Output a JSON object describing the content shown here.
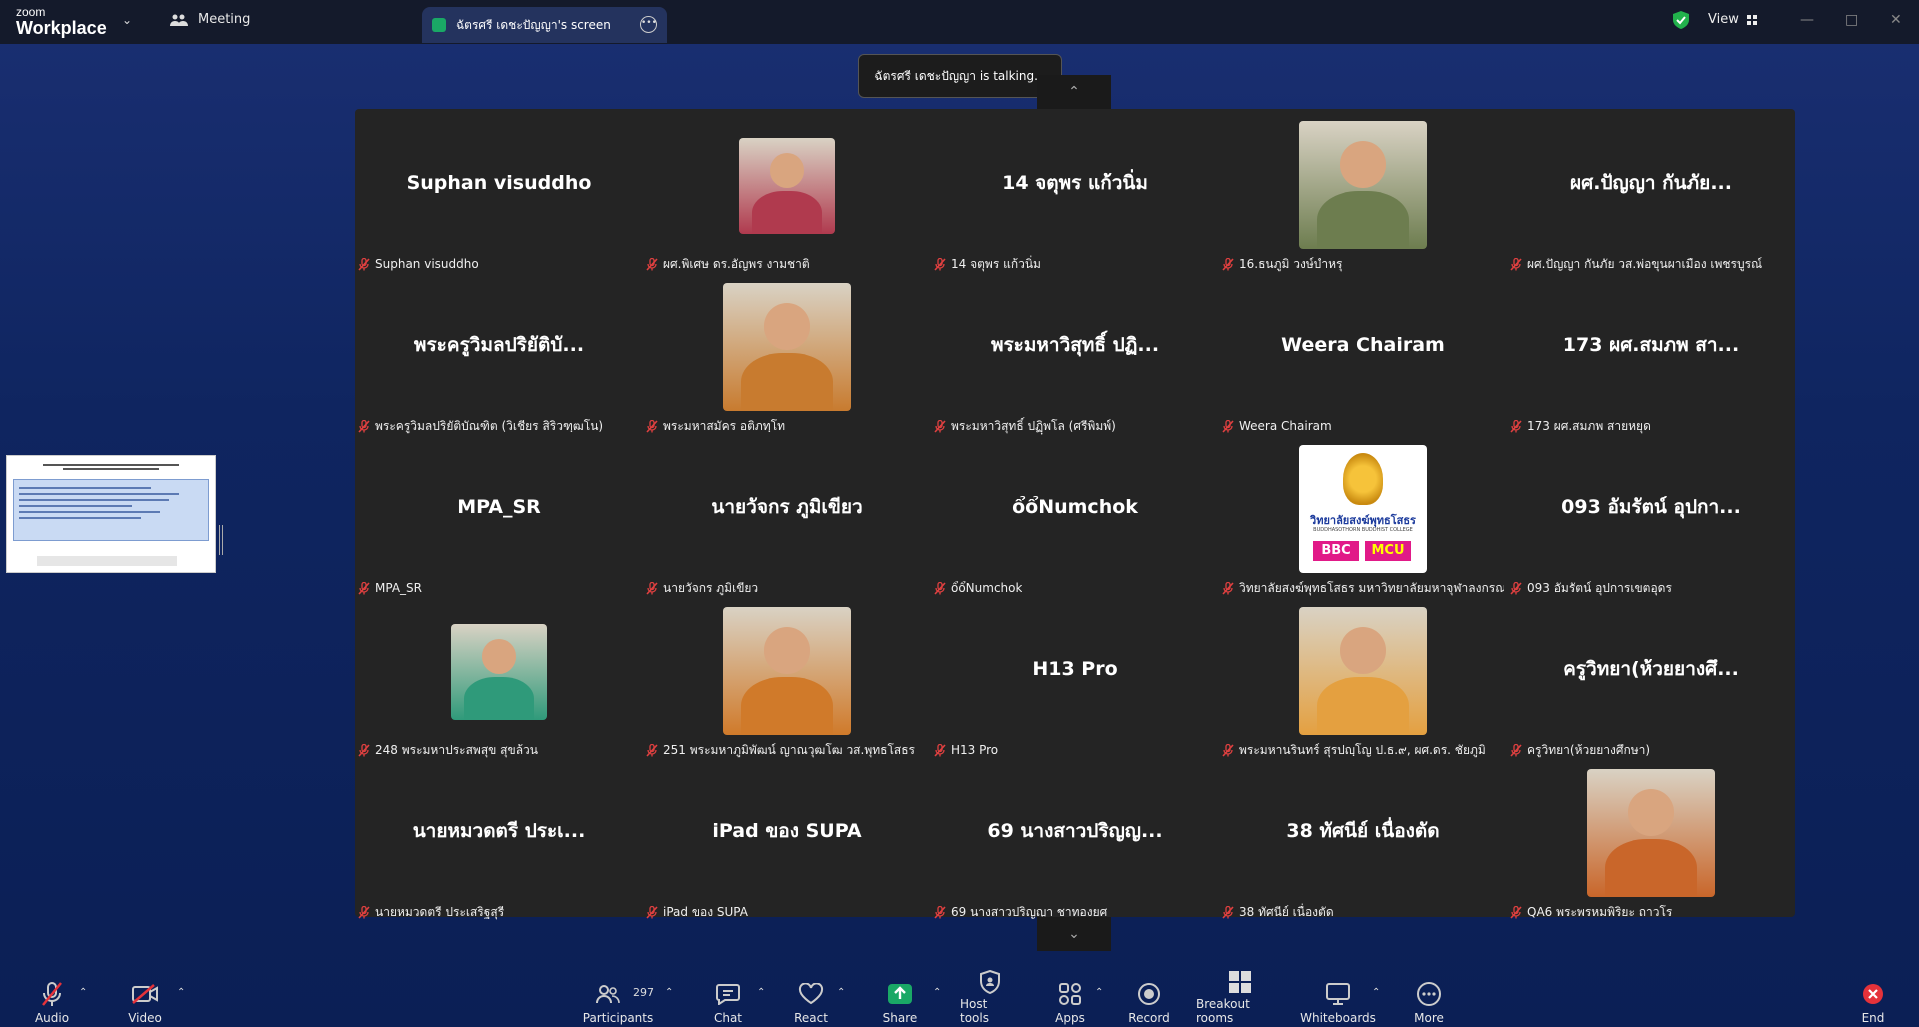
{
  "app": {
    "logo_top": "zoom",
    "logo_bottom": "Workplace"
  },
  "tabs": {
    "meeting": "Meeting",
    "screen": "ฉัตรศรี เดชะปัญญา's screen"
  },
  "view_label": "View",
  "talking": "ฉัตรศรี เดชะปัญญา is talking...",
  "participants": [
    {
      "big": "Suphan visuddho",
      "label": "Suphan visuddho"
    },
    {
      "big": "",
      "label": "ผศ.พิเศษ ดร.อัญพร งามชาติ",
      "photo": "portrait-woman",
      "color": "#b03a4e"
    },
    {
      "big": "14 จตุพร แก้วนิ่ม",
      "label": "14 จตุพร แก้วนิ่ม"
    },
    {
      "big": "",
      "label": "16.ธนภูมิ วงษ์บำหรุ",
      "photo": "tractor-field",
      "color": "#6d7d4f"
    },
    {
      "big": "ผศ.ปัญญา กันภัย...",
      "label": "ผศ.ปัญญา กันภัย วส.พ่อขุนผาเมือง เพชรบูรณ์"
    },
    {
      "big": "พระครูวิมลปริยัติบั...",
      "label": "พระครูวิมลปริยัติบัณฑิต (วิเชียร สิริวฑฺฒโน)"
    },
    {
      "big": "",
      "label": "พระมหาสมัคร อติภทฺโท",
      "photo": "monk-desk",
      "color": "#c87b2f"
    },
    {
      "big": "พระมหาวิสุทธิ์ ปฏิ...",
      "label": "พระมหาวิสุทธิ์ ปฏิฺพโล (ศรีพิมพ์)"
    },
    {
      "big": "Weera Chairam",
      "label": "Weera Chairam"
    },
    {
      "big": "173 ผศ.สมภพ สา...",
      "label": "173 ผศ.สมภพ สายหยุด"
    },
    {
      "big": "MPA_SR",
      "label": "MPA_SR"
    },
    {
      "big": "นายวัจกร ภูมิเขียว",
      "label": "นายวัจกร ภูมิเขียว"
    },
    {
      "big": "ổổNumchok",
      "label": "ổổNumchok"
    },
    {
      "big": "",
      "label": "วิทยาลัยสงฆ์พุทธโสธร มหาวิทยาลัยมหาจุฬาลงกรณ...",
      "photo": "college-logo",
      "color": "#ffffff",
      "logo_text": "วิทยาลัยสงฆ์พุทธโสธร",
      "logo_sub": "BUDDHASOTHORN BUDDHIST COLLEGE",
      "logo_a": "BBC",
      "logo_b": "MCU"
    },
    {
      "big": "093 อัมรัตน์ อุปกา...",
      "label": "093 อัมรัตน์ อุปการเขตอุดร"
    },
    {
      "big": "",
      "label": "248 พระมหาประสพสุข สุขล้วน",
      "photo": "monk-board",
      "color": "#2f9a7a"
    },
    {
      "big": "",
      "label": "251 พระมหาภูมิพัฒน์ ญาณวุฒโฒ วส.พุทธโสธร",
      "photo": "monk-garden",
      "color": "#d07a2a"
    },
    {
      "big": "H13 Pro",
      "label": "H13 Pro"
    },
    {
      "big": "",
      "label": "พระมหานรินทร์ สุรปญฺโญ ป.ธ.๙, ผศ.ดร. ชัยภูมิ",
      "photo": "monk-glasses",
      "color": "#e4a040"
    },
    {
      "big": "ครูวิทยา(ห้วยยางศึ...",
      "label": "ครูวิทยา(ห้วยยางศึกษา)"
    },
    {
      "big": "นายหมวดตรี ประเ...",
      "label": "นายหมวดตรี ประเสริฐสุรี"
    },
    {
      "big": "iPad ของ SUPA",
      "label": "iPad ของ SUPA"
    },
    {
      "big": "69 นางสาวปริญญ...",
      "label": "69 นางสาวปริญญา ชาทองยศ"
    },
    {
      "big": "38 ทัศนีย์ เนื่องตัด",
      "label": "38 ทัศนีย์ เนื่องตัด"
    },
    {
      "big": "",
      "label": "QA6 พระพรหมพิริยะ ถาวโร",
      "photo": "monk-selfie",
      "color": "#c9662a"
    }
  ],
  "toolbar": {
    "audio": "Audio",
    "video": "Video",
    "participants": "Participants",
    "participants_count": "297",
    "chat": "Chat",
    "react": "React",
    "share": "Share",
    "host_tools": "Host tools",
    "apps": "Apps",
    "record": "Record",
    "breakout": "Breakout rooms",
    "whiteboards": "Whiteboards",
    "more": "More",
    "end": "End"
  }
}
